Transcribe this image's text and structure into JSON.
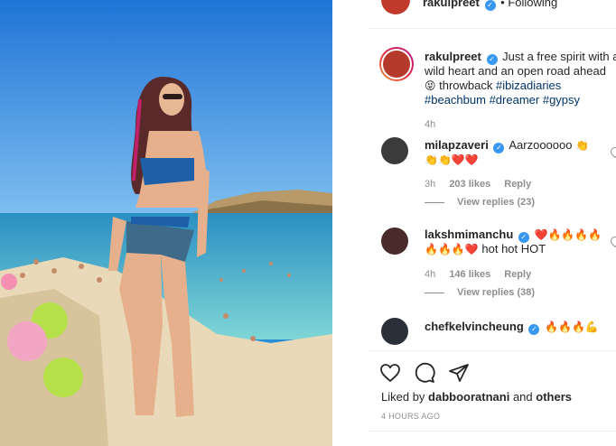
{
  "header": {
    "username": "rakulpreet",
    "separator": "•",
    "follow_state": "Following"
  },
  "caption": {
    "username": "rakulpreet",
    "line1": "Just a free spirit with a",
    "line2": "wild heart and an open road ahead",
    "line3_text": "throwback",
    "hashtag1": "#ibizadiaries",
    "hashtag2": "#beachbum",
    "hashtag3": "#dreamer",
    "hashtag4": "#gypsy",
    "emoji": "😝",
    "age": "4h"
  },
  "comments": [
    {
      "username": "milapzaveri",
      "text": "Aarzoooooo",
      "emoji_line1": "👏",
      "emoji_line2": "👏👏❤️❤️",
      "age": "3h",
      "likes": "203 likes",
      "reply": "Reply",
      "view_replies": "View replies (23)"
    },
    {
      "username": "lakshmimanchu",
      "emoji_line1": "❤️🔥🔥🔥🔥",
      "emoji_line2": "🔥🔥🔥❤️",
      "text": "hot hot HOT",
      "age": "4h",
      "likes": "146 likes",
      "reply": "Reply",
      "view_replies": "View replies (38)"
    },
    {
      "username": "chefkelvincheung",
      "emoji_line1": "🔥🔥🔥💪"
    }
  ],
  "footer": {
    "liked_by_prefix": "Liked by",
    "liked_by_user": "dabbooratnani",
    "liked_by_suffix": "and",
    "liked_by_others": "others",
    "timestamp": "4 HOURS AGO"
  },
  "icons": {
    "like": "heart-icon",
    "comment": "comment-icon",
    "share": "share-icon",
    "verified": "verified-badge-icon"
  },
  "colors": {
    "verified": "#3897f0",
    "hashtag": "#003569",
    "muted": "#8e8e8e"
  }
}
